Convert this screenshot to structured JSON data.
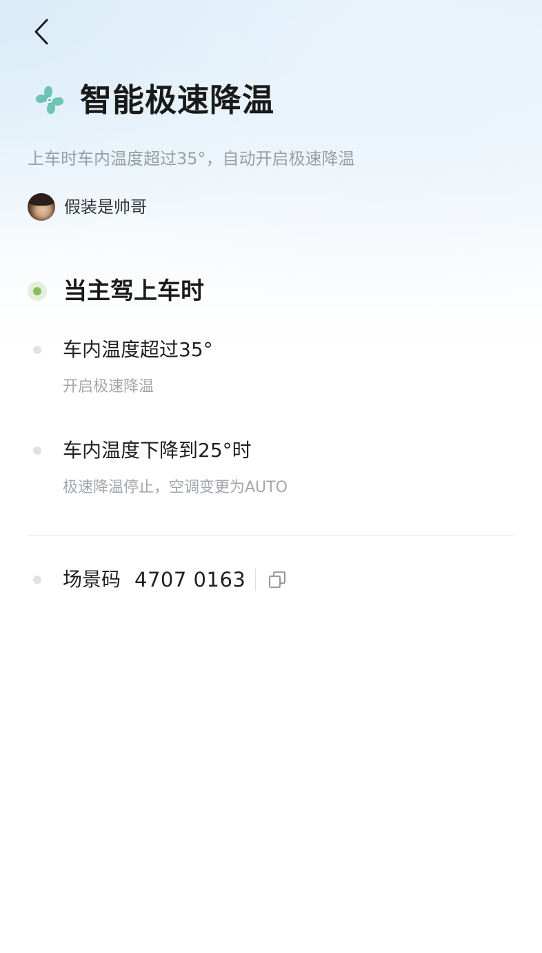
{
  "page": {
    "title": "智能极速降温",
    "description": "上车时车内温度超过35°，自动开启极速降温",
    "author_name": "假装是帅哥"
  },
  "trigger": {
    "label": "当主驾上车时"
  },
  "steps": [
    {
      "title": "车内温度超过35°",
      "desc": "开启极速降温"
    },
    {
      "title": "车内温度下降到25°时",
      "desc": "极速降温停止，空调变更为AUTO"
    }
  ],
  "scene": {
    "label": "场景码",
    "code": "4707 0163"
  },
  "icons": {
    "back": "chevron-left-icon",
    "title": "fan-icon",
    "copy": "copy-icon"
  },
  "colors": {
    "accent_green": "#8cbc5e",
    "fan_teal": "#6fc3b2",
    "text_secondary": "#9b9ea3"
  }
}
